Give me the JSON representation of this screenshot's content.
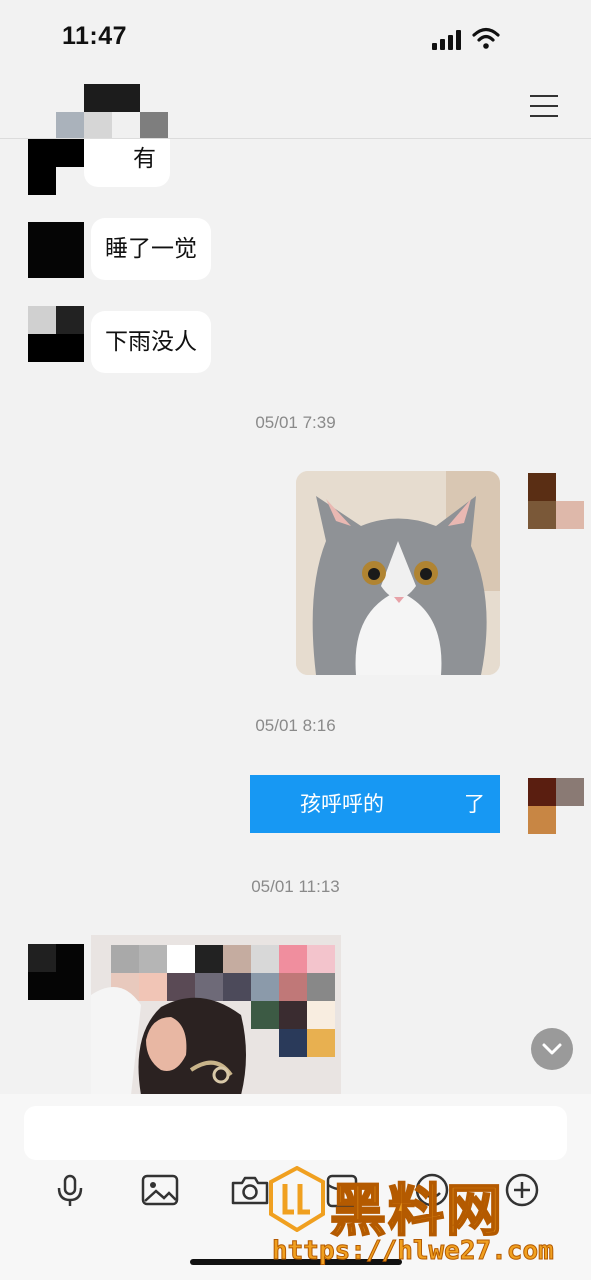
{
  "status_bar": {
    "time": "11:47"
  },
  "messages": {
    "m1": "有",
    "m2": "睡了一觉",
    "m3": "下雨没人",
    "ts1": "05/01 7:39",
    "ts2": "05/01 8:16",
    "m_blue_a": "孩呼呼的",
    "m_blue_b": "了",
    "ts3": "05/01 11:13"
  },
  "watermark": {
    "title": "黑料网",
    "url": "https://hlwe27.com"
  },
  "colors": {
    "accent_blue": "#1798f3",
    "bubble_white": "#ffffff",
    "background": "#f2f2f2",
    "watermark": "#f0a020"
  },
  "icons": [
    "menu-icon",
    "microphone-icon",
    "image-icon",
    "camera-icon",
    "red-packet-icon",
    "emoji-icon",
    "plus-icon",
    "chevron-down-icon"
  ]
}
